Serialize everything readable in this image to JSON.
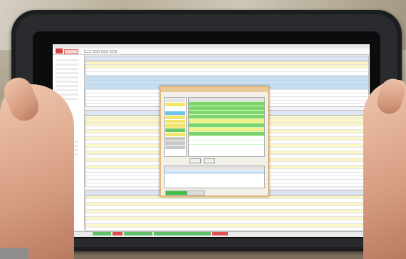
{
  "scene": {
    "description_colors": {
      "tablet_body": "#1c1d1f",
      "screen_bg": "#f4f4f4",
      "accent_red": "#d94141",
      "grid_yellow": "#fbf6c9",
      "grid_blue": "#bfdcf3",
      "dialog_border": "#e0b77f",
      "green_cells": "#7fd36b"
    }
  },
  "app": {
    "tabs": [
      "",
      "",
      "",
      ""
    ]
  },
  "dialog": {
    "progress": 0.55
  }
}
